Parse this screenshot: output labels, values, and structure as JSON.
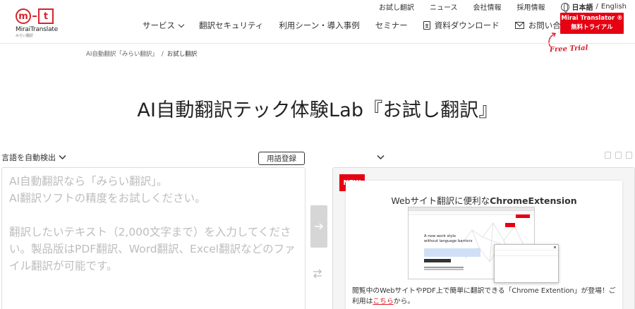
{
  "header": {
    "logo": {
      "mark_m": "m",
      "mark_t": "t",
      "brand": "MiraiTranslate",
      "brand_sub": "みらい翻訳"
    },
    "top_links": [
      "お試し翻訳",
      "ニュース",
      "会社情報",
      "採用情報"
    ],
    "language": {
      "current": "日本語",
      "separator": " / ",
      "other": "English"
    },
    "nav": [
      {
        "label": "サービス",
        "has_dropdown": true
      },
      {
        "label": "翻訳セキュリティ",
        "has_dropdown": false
      },
      {
        "label": "利用シーン・導入事例",
        "has_dropdown": false
      },
      {
        "label": "セミナー",
        "has_dropdown": false
      },
      {
        "label": "資料ダウンロード",
        "icon": "document-icon"
      },
      {
        "label": "お問い合わせ",
        "icon": "mail-icon",
        "has_dropdown": true
      }
    ],
    "trial_button": {
      "line1": "Mirai Translator ®",
      "line2": "無料トライアル"
    },
    "free_trial_note": "Free Trial",
    "accent_color": "#e60012"
  },
  "breadcrumb": {
    "home": "AI自動翻訳「みらい翻訳」",
    "separator": "/",
    "current": "お試し翻訳"
  },
  "page_title": "AI自動翻訳テック体験Lab『お試し翻訳』",
  "translator": {
    "source_language": "言語を自動検出",
    "glossary_button": "用語登録",
    "placeholder_lines": [
      "AI自動翻訳なら「みらい翻訳」。",
      "AI翻訳ソフトの精度をお試しください。",
      "翻訳したいテキスト（2,000文字まで）を入力してくださ",
      "い。製品版はPDF翻訳、Word翻訳、Excel翻訳などのファ",
      "イル翻訳が可能です。"
    ],
    "translate_icon": "arrow-right-icon",
    "swap_icon": "swap-icon"
  },
  "promo": {
    "badge": "NEW",
    "title_prefix": "Webサイト翻訳に便利な",
    "title_bold": "ChromeExtension",
    "mock_heading_1": "A new work style",
    "mock_heading_2": "without language barriers",
    "desc_before": "閲覧中のWebサイトやPDF上で簡単に翻訳できる「Chrome Extention」が登場！ご利用は",
    "desc_link": "こちら",
    "desc_after": "から。"
  }
}
